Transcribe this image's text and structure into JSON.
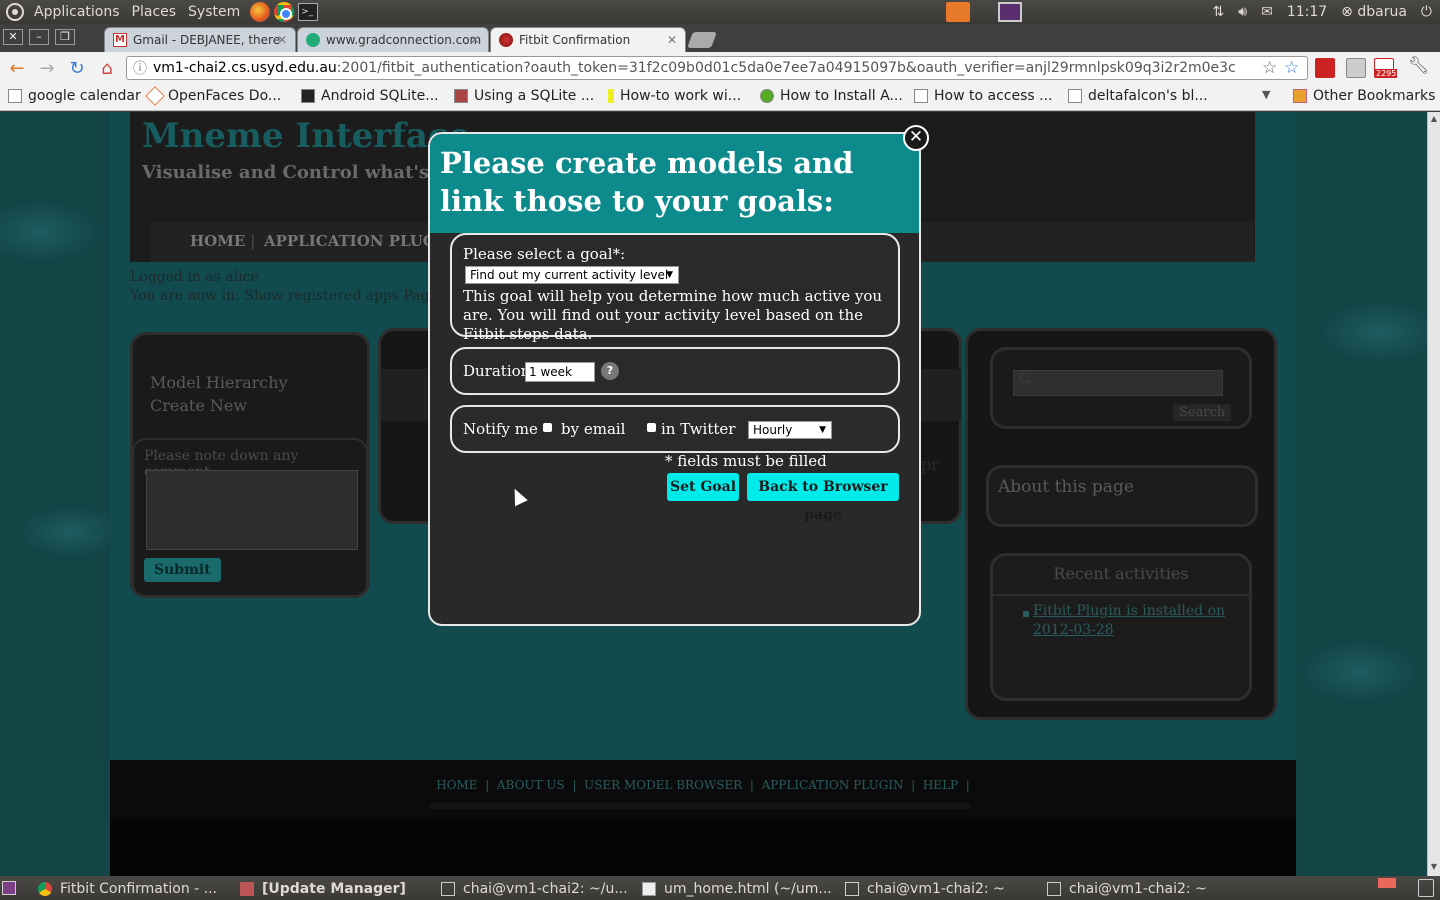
{
  "top_panel": {
    "menus": [
      "Applications",
      "Places",
      "System"
    ],
    "clock": "11:17",
    "user": "dbarua"
  },
  "browser": {
    "tabs": [
      {
        "title": "Gmail - DEBJANEE, there",
        "icon": "gmail-icon"
      },
      {
        "title": "www.gradconnection.com",
        "icon": "gradconnection-icon"
      },
      {
        "title": "Fitbit Confirmation",
        "icon": "fitbit-icon",
        "active": true
      }
    ],
    "url_host": "vm1-chai2.cs.usyd.edu.au",
    "url_rest": ":2001/fitbit_authentication?oauth_token=31f2c09b0d01c5da0e7ee7a04915097b&oauth_verifier=anjl29rmnlpsk09q3i2r2m0e3c",
    "gmail_badge": "2295",
    "bookmarks": [
      "google calendar",
      "OpenFaces Do...",
      "Android SQLite...",
      "Using a SQLite ...",
      "How-to work wi...",
      "How to Install A...",
      "How to access ...",
      "deltafalcon's bl..."
    ],
    "other_bookmarks": "Other Bookmarks"
  },
  "page": {
    "site_title": "Mneme Interface",
    "site_subtitle": "Visualise and Control what's insi",
    "nav": [
      "HOME",
      "APPLICATION PLUG"
    ],
    "logged_in": "Logged in as alice",
    "location": "You are now in: Show registered apps Page",
    "left_panel": {
      "items": [
        "Model Hierarchy",
        "Create New"
      ],
      "comment_label": "Please note down any comment",
      "submit": "Submit"
    },
    "right_panel": {
      "search_button": "Search",
      "about_title": "About this page",
      "recent_title": "Recent activities",
      "recent_item": "Fitbit Plugin is installed on 2012-03-28"
    },
    "footer_links": [
      "HOME",
      "ABOUT US",
      "USER MODEL BROWSER",
      "APPLICATION PLUGIN",
      "HELP"
    ],
    "peek_text": "pr"
  },
  "modal": {
    "title": "Please create models and link those to your goals:",
    "goal_label": "Please select a goal*:",
    "goal_selected": "Find out my current activity level",
    "goal_description": "This goal will help you determine how much active you are. You will find out your activity level based on the Fitbit steps data.",
    "duration_label": "Duration",
    "duration_value": "1 week",
    "help": "?",
    "notify_label": "Notify me",
    "by_email": "by email",
    "in_twitter": "in Twitter",
    "frequency_selected": "Hourly",
    "required_note": "* fields must be filled",
    "set_goal": "Set Goal",
    "back": "Back to Browser page",
    "close": "✕"
  },
  "taskbar": {
    "items": [
      "Fitbit Confirmation - ...",
      "[Update Manager]",
      "chai@vm1-chai2: ~/u...",
      "um_home.html (~/um...",
      "chai@vm1-chai2: ~",
      "chai@vm1-chai2: ~"
    ]
  }
}
